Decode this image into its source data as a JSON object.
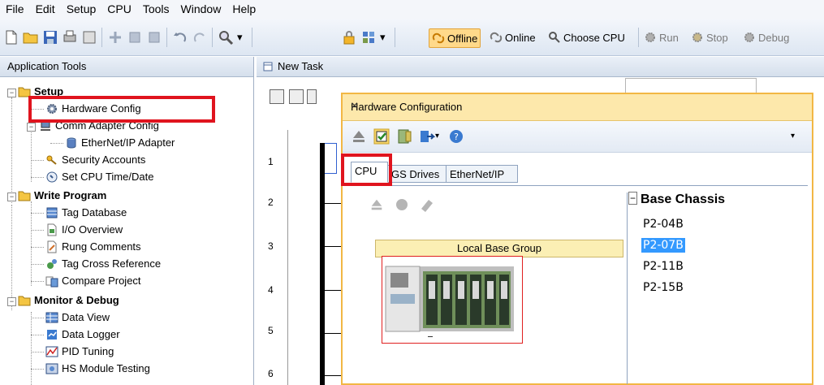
{
  "menu": [
    "File",
    "Edit",
    "Setup",
    "CPU",
    "Tools",
    "Window",
    "Help"
  ],
  "toolbar": {
    "offline": "Offline",
    "online": "Online",
    "choose_cpu": "Choose CPU",
    "run": "Run",
    "stop": "Stop",
    "debug": "Debug"
  },
  "app_tools": {
    "title": "Application Tools",
    "setup": "Setup",
    "hardware_config": "Hardware Config",
    "comm_adapter": "Comm Adapter Config",
    "ethernet_ip_adapter": "EtherNet/IP Adapter",
    "security_accounts": "Security Accounts",
    "set_cpu_time": "Set CPU Time/Date",
    "write_program": "Write Program",
    "tag_database": "Tag Database",
    "io_overview": "I/O Overview",
    "rung_comments": "Rung Comments",
    "tag_cross_ref": "Tag Cross Reference",
    "compare_project": "Compare Project",
    "monitor_debug": "Monitor & Debug",
    "data_view": "Data View",
    "data_logger": "Data Logger",
    "pid_tuning": "PID Tuning",
    "hs_module": "HS Module Testing"
  },
  "task": {
    "tab_label": "New Task",
    "rung_numbers": [
      "1",
      "2",
      "3",
      "4",
      "5",
      "6"
    ]
  },
  "dialog": {
    "title": "Hardware Configuration",
    "close": "×",
    "tabs": [
      "CPU",
      "GS Drives",
      "EtherNet/IP"
    ],
    "local_base_group": "Local Base Group",
    "base_chassis_title": "Base Chassis",
    "base_chassis": [
      "P2-04B",
      "P2-07B",
      "P2-11B",
      "P2-15B"
    ],
    "selected": "P2-07B"
  },
  "colors": {
    "highlight_red": "#e0141e",
    "dialog_border": "#f2b744",
    "selection_blue": "#3399ff"
  }
}
